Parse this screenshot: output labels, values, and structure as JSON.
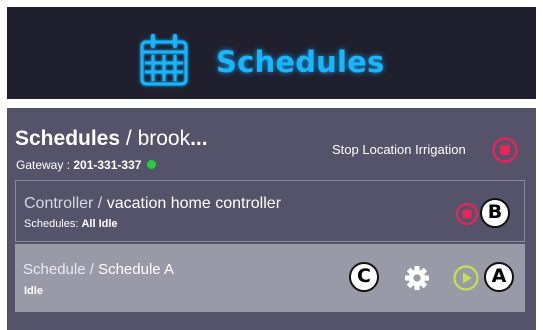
{
  "header": {
    "title": "Schedules",
    "icon": "calendar-icon",
    "title_color": "#19b6ff",
    "background": "#1f1f2e"
  },
  "panel": {
    "title_bold": "Schedules",
    "title_sep": " / ",
    "title_location": "brook",
    "title_ellipsis": "...",
    "gateway_label": "Gateway : ",
    "gateway_value": "201-331-337",
    "gateway_status_color": "#22d13a",
    "stop_location_label": "Stop Location Irrigation",
    "stop_icon": "stop-circle-icon",
    "stop_color": "#e8245a",
    "background": "#545369"
  },
  "controller": {
    "type_label": "Controller",
    "sep": " / ",
    "name": "vacation home controller",
    "sub_label": "Schedules: ",
    "sub_value": "All Idle",
    "stop_icon": "stop-circle-icon"
  },
  "schedule": {
    "type_label": "Schedule",
    "sep": " / ",
    "name": "Schedule A",
    "status": "Idle",
    "settings_icon": "gear-icon",
    "play_icon": "play-circle-icon",
    "play_color": "#c7e04f",
    "background": "#9999a8"
  },
  "callouts": {
    "a": "A",
    "b": "B",
    "c": "C"
  }
}
